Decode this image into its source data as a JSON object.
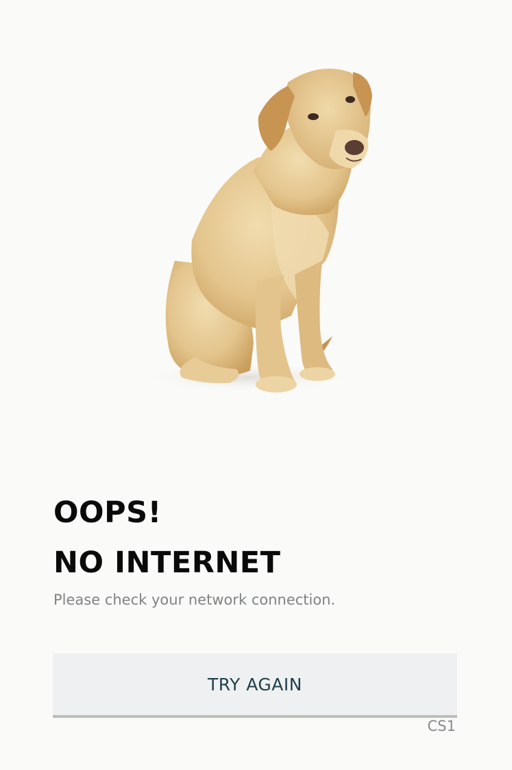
{
  "illustration": {
    "icon": "sad-dog-illustration",
    "colors": {
      "fur": "#e3c48c",
      "fur_shadow": "#c99d5c",
      "ear": "#c79452",
      "nose": "#5a3e33",
      "eye": "#3b2a22"
    }
  },
  "message": {
    "title_line1": "OOPS!",
    "title_line2": "NO INTERNET",
    "subtitle": "Please check your network connection."
  },
  "actions": {
    "try_again_label": "TRY AGAIN"
  },
  "footer": {
    "code": "CS1"
  },
  "colors": {
    "background": "#fafaf8",
    "title": "#0a0a0a",
    "subtitle": "#7e8384",
    "button_bg": "#eff0f1",
    "button_text": "#1f3f4c",
    "button_border": "#bcbcbc"
  }
}
